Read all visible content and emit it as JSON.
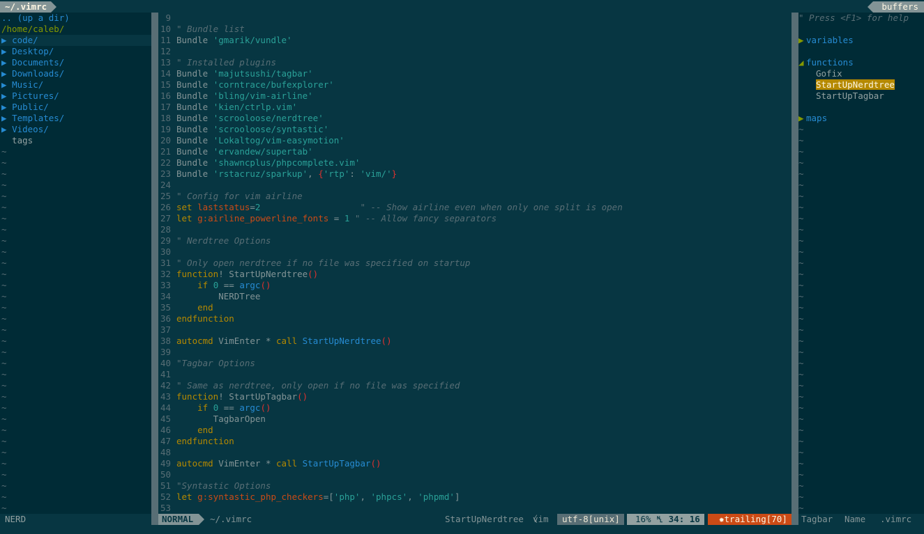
{
  "tabline": {
    "tab_label": "~/.vimrc",
    "right_label": "buffers"
  },
  "nerdtree": {
    "updir": ".. (up a dir)",
    "cwd": "/home/caleb/",
    "dirs": [
      "code/",
      "Desktop/",
      "Documents/",
      "Downloads/",
      "Music/",
      "Pictures/",
      "Public/",
      "Templates/",
      "Videos/"
    ],
    "files": [
      "tags"
    ],
    "arrow": "▶",
    "tilde": "~"
  },
  "editor": {
    "lines": [
      {
        "n": "9",
        "t": []
      },
      {
        "n": "10",
        "t": [
          [
            "c",
            "\" Bundle list"
          ]
        ]
      },
      {
        "n": "11",
        "t": [
          [
            "p",
            "Bundle "
          ],
          [
            "s",
            "'gmarik/vundle'"
          ]
        ]
      },
      {
        "n": "12",
        "t": []
      },
      {
        "n": "13",
        "t": [
          [
            "c",
            "\" Installed plugins"
          ]
        ]
      },
      {
        "n": "14",
        "t": [
          [
            "p",
            "Bundle "
          ],
          [
            "s",
            "'majutsushi/tagbar'"
          ]
        ]
      },
      {
        "n": "15",
        "t": [
          [
            "p",
            "Bundle "
          ],
          [
            "s",
            "'corntrace/bufexplorer'"
          ]
        ]
      },
      {
        "n": "16",
        "t": [
          [
            "p",
            "Bundle "
          ],
          [
            "s",
            "'bling/vim-airline'"
          ]
        ]
      },
      {
        "n": "17",
        "t": [
          [
            "p",
            "Bundle "
          ],
          [
            "s",
            "'kien/ctrlp.vim'"
          ]
        ]
      },
      {
        "n": "18",
        "t": [
          [
            "p",
            "Bundle "
          ],
          [
            "s",
            "'scrooloose/nerdtree'"
          ]
        ]
      },
      {
        "n": "19",
        "t": [
          [
            "p",
            "Bundle "
          ],
          [
            "s",
            "'scrooloose/syntastic'"
          ]
        ]
      },
      {
        "n": "20",
        "t": [
          [
            "p",
            "Bundle "
          ],
          [
            "s",
            "'Lokaltog/vim-easymotion'"
          ]
        ]
      },
      {
        "n": "21",
        "t": [
          [
            "p",
            "Bundle "
          ],
          [
            "s",
            "'ervandew/supertab'"
          ]
        ]
      },
      {
        "n": "22",
        "t": [
          [
            "p",
            "Bundle "
          ],
          [
            "s",
            "'shawncplus/phpcomplete.vim'"
          ]
        ]
      },
      {
        "n": "23",
        "t": [
          [
            "p",
            "Bundle "
          ],
          [
            "s",
            "'rstacruz/sparkup'"
          ],
          [
            "p",
            ", "
          ],
          [
            "r",
            "{"
          ],
          [
            "s",
            "'rtp'"
          ],
          [
            "p",
            ": "
          ],
          [
            "s",
            "'vim/'"
          ],
          [
            "r",
            "}"
          ]
        ]
      },
      {
        "n": "24",
        "t": []
      },
      {
        "n": "25",
        "t": [
          [
            "c",
            "\" Config for vim airline"
          ]
        ]
      },
      {
        "n": "26",
        "t": [
          [
            "k",
            "set "
          ],
          [
            "v",
            "laststatus"
          ],
          [
            "p",
            "="
          ],
          [
            "s",
            "2"
          ],
          [
            "p",
            "                   "
          ],
          [
            "c",
            "\" -- Show airline even when only one split is open"
          ]
        ]
      },
      {
        "n": "27",
        "t": [
          [
            "k",
            "let "
          ],
          [
            "v",
            "g:airline_powerline_fonts"
          ],
          [
            "p",
            " = "
          ],
          [
            "s",
            "1"
          ],
          [
            "p",
            " "
          ],
          [
            "c",
            "\" -- Allow fancy separators"
          ]
        ]
      },
      {
        "n": "28",
        "t": []
      },
      {
        "n": "29",
        "t": [
          [
            "c",
            "\" Nerdtree Options"
          ]
        ]
      },
      {
        "n": "30",
        "t": []
      },
      {
        "n": "31",
        "t": [
          [
            "c",
            "\" Only open nerdtree if no file was specified on startup"
          ]
        ]
      },
      {
        "n": "32",
        "t": [
          [
            "k",
            "function"
          ],
          [
            "p",
            "! StartUpNerdtree"
          ],
          [
            "r",
            "()"
          ]
        ]
      },
      {
        "n": "33",
        "t": [
          [
            "p",
            "    "
          ],
          [
            "k",
            "if "
          ],
          [
            "s",
            "0"
          ],
          [
            "p",
            " == "
          ],
          [
            "f",
            "argc"
          ],
          [
            "r",
            "()"
          ]
        ]
      },
      {
        "n": "34",
        "t": [
          [
            "p",
            "        NERDTree"
          ]
        ]
      },
      {
        "n": "35",
        "t": [
          [
            "p",
            "    "
          ],
          [
            "k",
            "end"
          ]
        ]
      },
      {
        "n": "36",
        "t": [
          [
            "k",
            "endfunction"
          ]
        ]
      },
      {
        "n": "37",
        "t": []
      },
      {
        "n": "38",
        "t": [
          [
            "k",
            "autocmd "
          ],
          [
            "p",
            "VimEnter * "
          ],
          [
            "k",
            "call "
          ],
          [
            "f",
            "StartUpNerdtree"
          ],
          [
            "r",
            "()"
          ]
        ]
      },
      {
        "n": "39",
        "t": []
      },
      {
        "n": "40",
        "t": [
          [
            "c",
            "\"Tagbar Options"
          ]
        ]
      },
      {
        "n": "41",
        "t": []
      },
      {
        "n": "42",
        "t": [
          [
            "c",
            "\" Same as nerdtree, only open if no file was specified"
          ]
        ]
      },
      {
        "n": "43",
        "t": [
          [
            "k",
            "function"
          ],
          [
            "p",
            "! StartUpTagbar"
          ],
          [
            "r",
            "()"
          ]
        ]
      },
      {
        "n": "44",
        "t": [
          [
            "p",
            "    "
          ],
          [
            "k",
            "if "
          ],
          [
            "s",
            "0"
          ],
          [
            "p",
            " == "
          ],
          [
            "f",
            "argc"
          ],
          [
            "r",
            "()"
          ]
        ]
      },
      {
        "n": "45",
        "t": [
          [
            "p",
            "       TagbarOpen"
          ]
        ]
      },
      {
        "n": "46",
        "t": [
          [
            "p",
            "    "
          ],
          [
            "k",
            "end"
          ]
        ]
      },
      {
        "n": "47",
        "t": [
          [
            "k",
            "endfunction"
          ]
        ]
      },
      {
        "n": "48",
        "t": []
      },
      {
        "n": "49",
        "t": [
          [
            "k",
            "autocmd "
          ],
          [
            "p",
            "VimEnter * "
          ],
          [
            "k",
            "call "
          ],
          [
            "f",
            "StartUpTagbar"
          ],
          [
            "r",
            "()"
          ]
        ]
      },
      {
        "n": "50",
        "t": []
      },
      {
        "n": "51",
        "t": [
          [
            "c",
            "\"Syntastic Options"
          ]
        ]
      },
      {
        "n": "52",
        "t": [
          [
            "k",
            "let "
          ],
          [
            "v",
            "g:syntastic_php_checkers"
          ],
          [
            "p",
            "=["
          ],
          [
            "s",
            "'php'"
          ],
          [
            "p",
            ", "
          ],
          [
            "s",
            "'phpcs'"
          ],
          [
            "p",
            ", "
          ],
          [
            "s",
            "'phpmd'"
          ],
          [
            "p",
            "]"
          ]
        ]
      },
      {
        "n": "53",
        "t": []
      }
    ]
  },
  "tagbar": {
    "help": "\" Press <F1> for help",
    "kinds": [
      {
        "label": "variables",
        "fold": "▶",
        "tags": []
      },
      {
        "label": "functions",
        "fold": "◢",
        "tags": [
          "Gofix",
          "StartUpNerdtree",
          "StartUpTagbar"
        ],
        "selected": "StartUpNerdtree"
      },
      {
        "label": "maps",
        "fold": "▶",
        "tags": []
      }
    ]
  },
  "statusline": {
    "nerd_label": "NERD",
    "mode": "NORMAL",
    "file": "~/.vimrc",
    "tag": "StartUpNerdtree",
    "sep_left": "〈",
    "filetype": "vim",
    "encoding": "utf-8[unix]",
    "percent": "16%",
    "ln_symbol": "␤",
    "position": " 34: 16",
    "warning": "trailing[70]",
    "warning_icon": "✹",
    "tagbar_label": "Tagbar",
    "tagbar_sort": "Name",
    "tagbar_file": ".vimrc"
  },
  "colors": {
    "background": "#073642",
    "panel_bg": "#002b36",
    "accent_yellow": "#b58900",
    "comment": "#586e75",
    "string": "#2aa198",
    "keyword": "#b58900",
    "function": "#268bd2",
    "warning_bg": "#cb4b16"
  }
}
